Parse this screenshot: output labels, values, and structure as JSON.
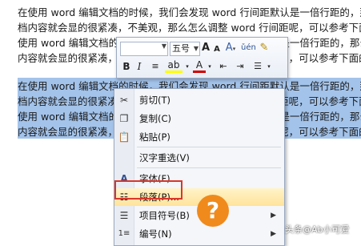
{
  "document": {
    "lines": [
      "在使用 word 编辑文档的时候，我们会发现 word 行间距默认是一倍行距的，那么",
      "档内容就会显的很紧凑，不美观，那么怎么调整 word 行间距呢，可以参考下面",
      "使用 word 编辑文档的时候，我们会发现 word 行间距默认是一倍行距的，那么",
      "内容就会显的很紧凑，不美观，那么怎么调整 word 行间距呢，可以参考下面的",
      "在使用 word 编辑文档的时候，我们会发现 word 行间距默认是一倍行距的，那",
      "档内容就会显的很紧凑，不美观，那么怎么调整 word 行间距呢，可以参考下面",
      "使用 word 编辑文档的时候，我们会发现 word 行间距默认是一倍行距的，那么",
      "内容就会显的很紧凑，不美观，那么怎么调整 word 行间距呢，可以参考下面的"
    ]
  },
  "minibar": {
    "font_size": "五号",
    "font_color": "#d00000",
    "highlight_color": "#ffff00"
  },
  "context_menu": {
    "items": [
      {
        "label": "剪切(T)",
        "icon": "scissors-icon"
      },
      {
        "label": "复制(C)",
        "icon": "copy-icon"
      },
      {
        "label": "粘贴(P)",
        "icon": "paste-icon"
      },
      {
        "label": "汉字重选(V)",
        "icon": ""
      },
      {
        "label": "字体(F)...",
        "icon": "font-icon"
      },
      {
        "label": "段落(P)...",
        "icon": "paragraph-icon"
      },
      {
        "label": "项目符号(B)",
        "icon": "bullets-icon"
      },
      {
        "label": "编号(N)",
        "icon": "numbering-icon"
      }
    ]
  },
  "watermark": {
    "text": "头条@Ab小可爱",
    "accent": "#f08a1c"
  },
  "colors": {
    "selection": "#a3c3ea",
    "highlight_border": "#d9362b"
  }
}
